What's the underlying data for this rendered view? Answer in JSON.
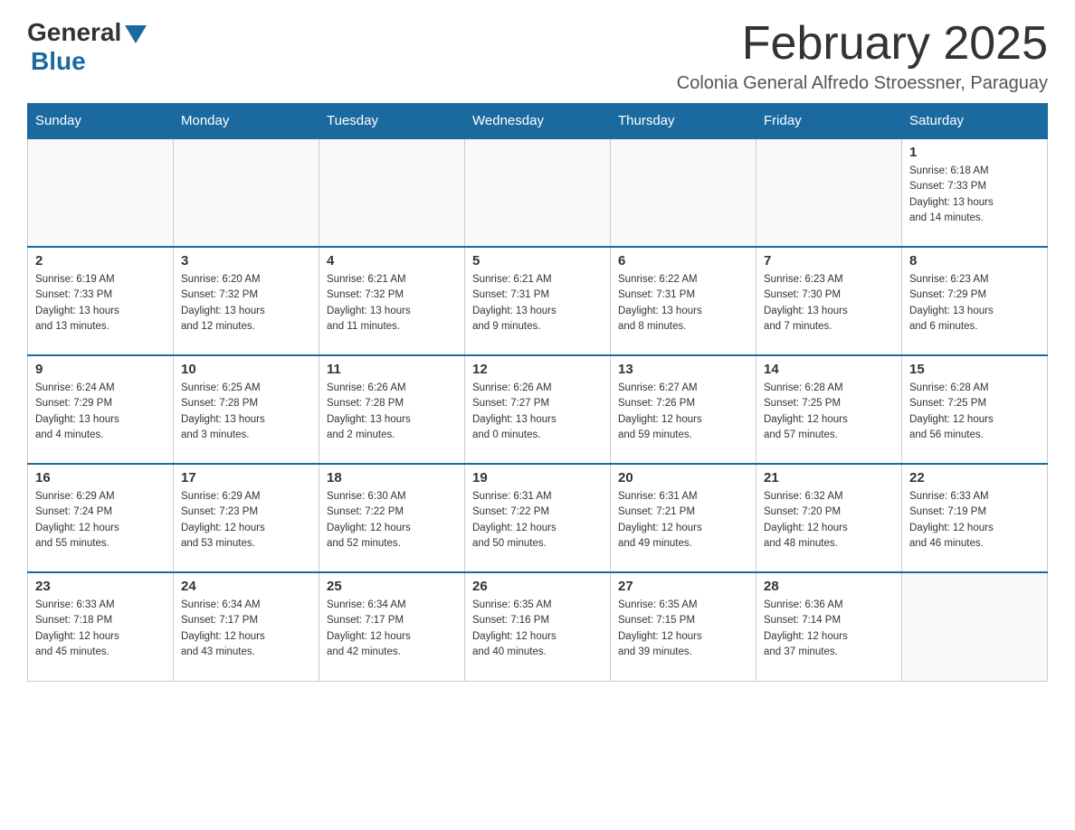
{
  "logo": {
    "general": "General",
    "blue": "Blue"
  },
  "header": {
    "title": "February 2025",
    "subtitle": "Colonia General Alfredo Stroessner, Paraguay"
  },
  "weekdays": [
    "Sunday",
    "Monday",
    "Tuesday",
    "Wednesday",
    "Thursday",
    "Friday",
    "Saturday"
  ],
  "weeks": [
    [
      {
        "day": "",
        "info": ""
      },
      {
        "day": "",
        "info": ""
      },
      {
        "day": "",
        "info": ""
      },
      {
        "day": "",
        "info": ""
      },
      {
        "day": "",
        "info": ""
      },
      {
        "day": "",
        "info": ""
      },
      {
        "day": "1",
        "info": "Sunrise: 6:18 AM\nSunset: 7:33 PM\nDaylight: 13 hours\nand 14 minutes."
      }
    ],
    [
      {
        "day": "2",
        "info": "Sunrise: 6:19 AM\nSunset: 7:33 PM\nDaylight: 13 hours\nand 13 minutes."
      },
      {
        "day": "3",
        "info": "Sunrise: 6:20 AM\nSunset: 7:32 PM\nDaylight: 13 hours\nand 12 minutes."
      },
      {
        "day": "4",
        "info": "Sunrise: 6:21 AM\nSunset: 7:32 PM\nDaylight: 13 hours\nand 11 minutes."
      },
      {
        "day": "5",
        "info": "Sunrise: 6:21 AM\nSunset: 7:31 PM\nDaylight: 13 hours\nand 9 minutes."
      },
      {
        "day": "6",
        "info": "Sunrise: 6:22 AM\nSunset: 7:31 PM\nDaylight: 13 hours\nand 8 minutes."
      },
      {
        "day": "7",
        "info": "Sunrise: 6:23 AM\nSunset: 7:30 PM\nDaylight: 13 hours\nand 7 minutes."
      },
      {
        "day": "8",
        "info": "Sunrise: 6:23 AM\nSunset: 7:29 PM\nDaylight: 13 hours\nand 6 minutes."
      }
    ],
    [
      {
        "day": "9",
        "info": "Sunrise: 6:24 AM\nSunset: 7:29 PM\nDaylight: 13 hours\nand 4 minutes."
      },
      {
        "day": "10",
        "info": "Sunrise: 6:25 AM\nSunset: 7:28 PM\nDaylight: 13 hours\nand 3 minutes."
      },
      {
        "day": "11",
        "info": "Sunrise: 6:26 AM\nSunset: 7:28 PM\nDaylight: 13 hours\nand 2 minutes."
      },
      {
        "day": "12",
        "info": "Sunrise: 6:26 AM\nSunset: 7:27 PM\nDaylight: 13 hours\nand 0 minutes."
      },
      {
        "day": "13",
        "info": "Sunrise: 6:27 AM\nSunset: 7:26 PM\nDaylight: 12 hours\nand 59 minutes."
      },
      {
        "day": "14",
        "info": "Sunrise: 6:28 AM\nSunset: 7:25 PM\nDaylight: 12 hours\nand 57 minutes."
      },
      {
        "day": "15",
        "info": "Sunrise: 6:28 AM\nSunset: 7:25 PM\nDaylight: 12 hours\nand 56 minutes."
      }
    ],
    [
      {
        "day": "16",
        "info": "Sunrise: 6:29 AM\nSunset: 7:24 PM\nDaylight: 12 hours\nand 55 minutes."
      },
      {
        "day": "17",
        "info": "Sunrise: 6:29 AM\nSunset: 7:23 PM\nDaylight: 12 hours\nand 53 minutes."
      },
      {
        "day": "18",
        "info": "Sunrise: 6:30 AM\nSunset: 7:22 PM\nDaylight: 12 hours\nand 52 minutes."
      },
      {
        "day": "19",
        "info": "Sunrise: 6:31 AM\nSunset: 7:22 PM\nDaylight: 12 hours\nand 50 minutes."
      },
      {
        "day": "20",
        "info": "Sunrise: 6:31 AM\nSunset: 7:21 PM\nDaylight: 12 hours\nand 49 minutes."
      },
      {
        "day": "21",
        "info": "Sunrise: 6:32 AM\nSunset: 7:20 PM\nDaylight: 12 hours\nand 48 minutes."
      },
      {
        "day": "22",
        "info": "Sunrise: 6:33 AM\nSunset: 7:19 PM\nDaylight: 12 hours\nand 46 minutes."
      }
    ],
    [
      {
        "day": "23",
        "info": "Sunrise: 6:33 AM\nSunset: 7:18 PM\nDaylight: 12 hours\nand 45 minutes."
      },
      {
        "day": "24",
        "info": "Sunrise: 6:34 AM\nSunset: 7:17 PM\nDaylight: 12 hours\nand 43 minutes."
      },
      {
        "day": "25",
        "info": "Sunrise: 6:34 AM\nSunset: 7:17 PM\nDaylight: 12 hours\nand 42 minutes."
      },
      {
        "day": "26",
        "info": "Sunrise: 6:35 AM\nSunset: 7:16 PM\nDaylight: 12 hours\nand 40 minutes."
      },
      {
        "day": "27",
        "info": "Sunrise: 6:35 AM\nSunset: 7:15 PM\nDaylight: 12 hours\nand 39 minutes."
      },
      {
        "day": "28",
        "info": "Sunrise: 6:36 AM\nSunset: 7:14 PM\nDaylight: 12 hours\nand 37 minutes."
      },
      {
        "day": "",
        "info": ""
      }
    ]
  ]
}
